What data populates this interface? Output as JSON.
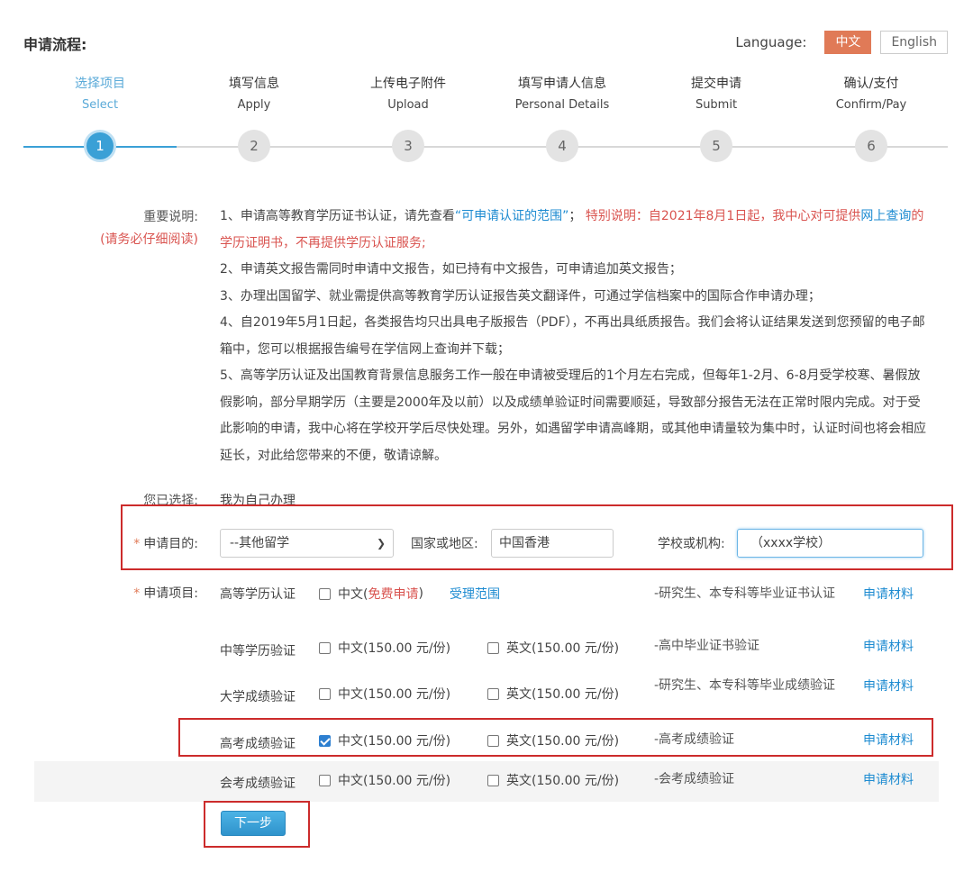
{
  "header": {
    "title": "申请流程:",
    "language_label": "Language:",
    "lang_cn": "中文",
    "lang_en": "English"
  },
  "steps": [
    {
      "cn": "选择项目",
      "en": "Select",
      "num": "1"
    },
    {
      "cn": "填写信息",
      "en": "Apply",
      "num": "2"
    },
    {
      "cn": "上传电子附件",
      "en": "Upload",
      "num": "3"
    },
    {
      "cn": "填写申请人信息",
      "en": "Personal Details",
      "num": "4"
    },
    {
      "cn": "提交申请",
      "en": "Submit",
      "num": "5"
    },
    {
      "cn": "确认/支付",
      "en": "Confirm/Pay",
      "num": "6"
    }
  ],
  "notes": {
    "label": "重要说明:",
    "sublabel": "(请务必仔细阅读)",
    "n1_a": "1、申请高等教育学历证书认证，请先查看",
    "n1_link": "“可申请认证的范围”",
    "n1_b": "；",
    "n1_special": "特别说明：自2021年8月1日起，我中心对可提供",
    "n1_link2": "网上查询",
    "n1_special2": "的学历证明书，不再提供学历认证服务;",
    "n2": "2、申请英文报告需同时申请中文报告，如已持有中文报告，可申请追加英文报告；",
    "n3": "3、办理出国留学、就业需提供高等教育学历认证报告英文翻译件，可通过学信档案中的国际合作申请办理；",
    "n4": "4、自2019年5月1日起，各类报告均只出具电子版报告（PDF），不再出具纸质报告。我们会将认证结果发送到您预留的电子邮箱中，您可以根据报告编号在学信网上查询并下载；",
    "n5": "5、高等学历认证及出国教育背景信息服务工作一般在申请被受理后的1个月左右完成，但每年1-2月、6-8月受学校寒、暑假放假影响，部分早期学历（主要是2000年及以前）以及成绩单验证时间需要顺延，导致部分报告无法在正常时限内完成。对于受此影响的申请，我中心将在学校开学后尽快处理。另外，如遇留学申请高峰期，或其他申请量较为集中时，认证时间也将会相应延长，对此给您带来的不便，敬请谅解。"
  },
  "chosen": {
    "label": "您已选择:",
    "value": "我为自己办理"
  },
  "purpose": {
    "required_mark": "*",
    "label": "申请目的:",
    "select_value": "--其他留学",
    "region_label": "国家或地区:",
    "region_value": "中国香港",
    "school_label": "学校或机构:",
    "school_value": "（xxxx学校）"
  },
  "projects": {
    "required_mark": "*",
    "label": "申请项目:",
    "rows": [
      {
        "name": "高等学历认证",
        "cn": "中文(",
        "cn_free": "免费申请",
        "cn_end": ")",
        "scope": "受理范围",
        "desc": "-研究生、本专科等毕业证书认证",
        "link": "申请材料"
      },
      {
        "name": "中等学历验证",
        "cn": "中文(150.00 元/份)",
        "en": "英文(150.00 元/份)",
        "desc": "-高中毕业证书验证",
        "link": "申请材料"
      },
      {
        "name": "大学成绩验证",
        "cn": "中文(150.00 元/份)",
        "en": "英文(150.00 元/份)",
        "desc": "-研究生、本专科等毕业成绩验证",
        "link": "申请材料"
      },
      {
        "name": "高考成绩验证",
        "cn": "中文(150.00 元/份)",
        "en": "英文(150.00 元/份)",
        "desc": "-高考成绩验证",
        "link": "申请材料",
        "cn_checked": true
      },
      {
        "name": "会考成绩验证",
        "cn": "中文(150.00 元/份)",
        "en": "英文(150.00 元/份)",
        "desc": "-会考成绩验证",
        "link": "申请材料"
      }
    ]
  },
  "next_button": "下一步",
  "colors": {
    "accent": "#3aa0d6",
    "lang_active": "#e07a57",
    "highlight_border": "#cc2b2b",
    "link": "#1d8bd1",
    "warning": "#d9534f"
  }
}
